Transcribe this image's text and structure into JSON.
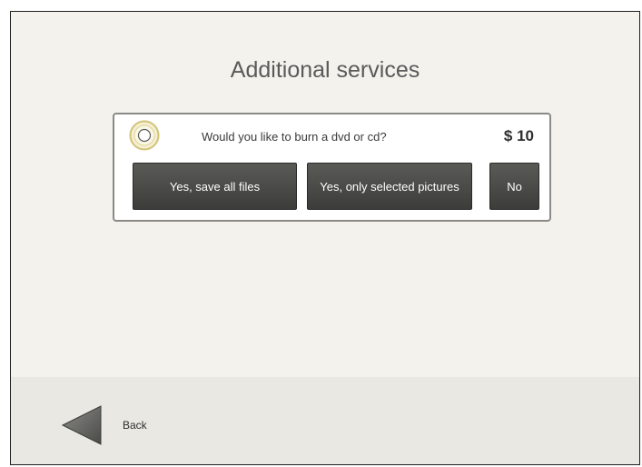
{
  "screen": {
    "title": "Additional services"
  },
  "service": {
    "icon": "disc-icon",
    "question": "Would you like to burn a dvd or cd?",
    "price": "$ 10",
    "options": {
      "save_all": "Yes, save all files",
      "selected_pictures": "Yes, only selected pictures",
      "no": "No"
    }
  },
  "footer": {
    "back_icon": "back-arrow-icon",
    "back_label": "Back"
  },
  "colors": {
    "background": "#f3f2ed",
    "footer": "#e9e8e3",
    "button": "#4a4a48",
    "disc_accent": "#d9c97a"
  }
}
